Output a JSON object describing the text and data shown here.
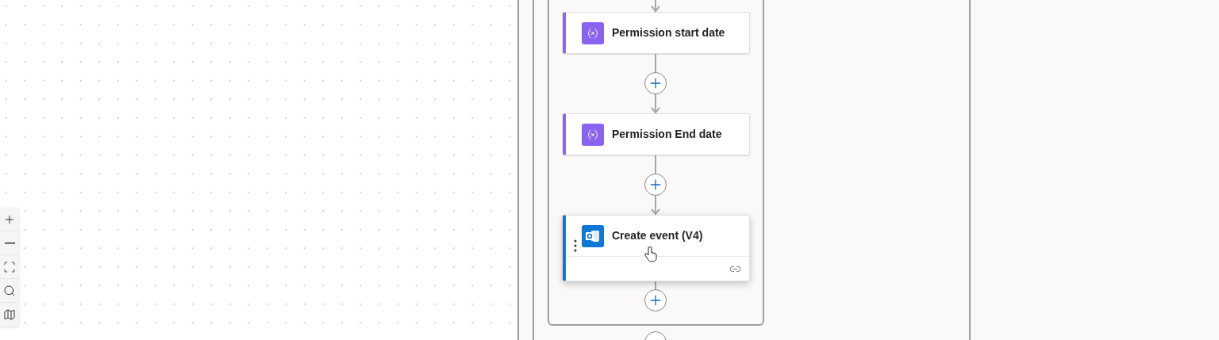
{
  "nodes": [
    {
      "title": "Permission start date",
      "kind": "variable",
      "color": "#8a63f0",
      "selected": false
    },
    {
      "title": "Permission End date",
      "kind": "variable",
      "color": "#8a63f0",
      "selected": false
    },
    {
      "title": "Create event (V4)",
      "kind": "connector",
      "color": "#0f78d4",
      "selected": true
    }
  ]
}
